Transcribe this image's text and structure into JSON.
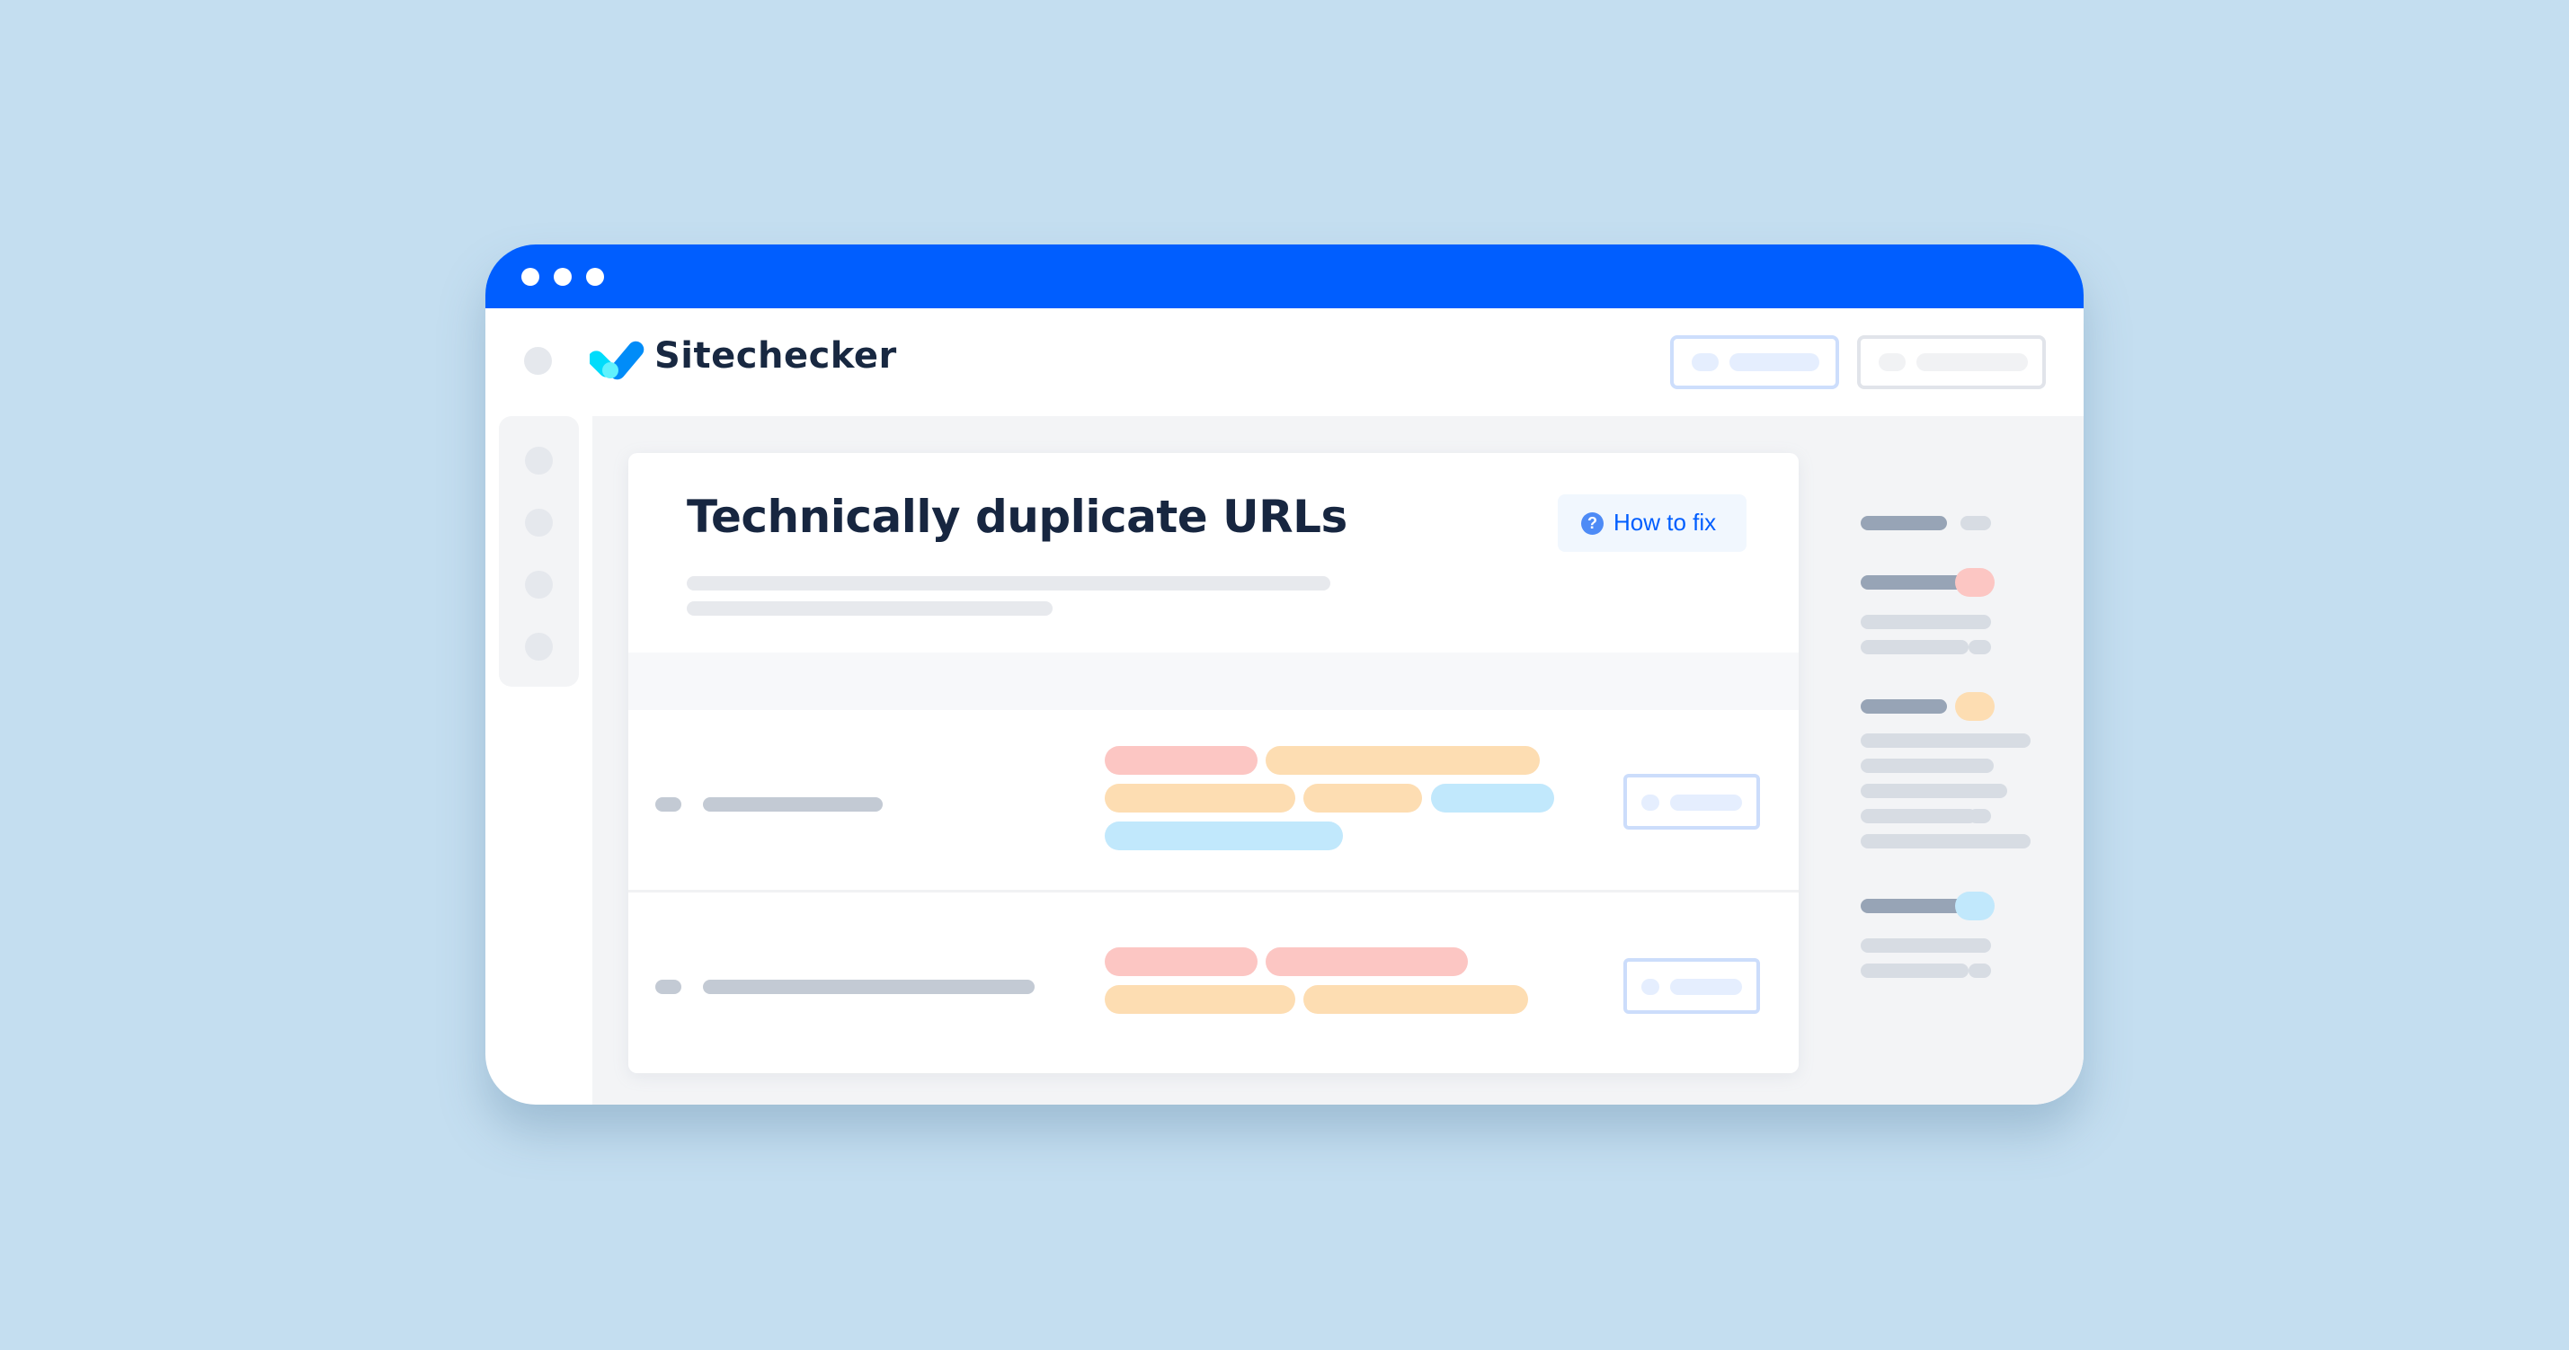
{
  "window": {
    "titlebar_color": "#005EFF",
    "traffic_dots": 3
  },
  "header": {
    "logo_text": "Sitechecker",
    "logo_icon": "checkmark-logo-icon",
    "buttons": [
      {
        "name": "primary-header-button",
        "style": "blue-outline"
      },
      {
        "name": "secondary-header-button",
        "style": "gray-outline"
      }
    ]
  },
  "sidebar": {
    "items": [
      "nav-item-1",
      "nav-item-2",
      "nav-item-3",
      "nav-item-4"
    ]
  },
  "main": {
    "title": "Technically duplicate URLs",
    "how_to_fix": {
      "label": "How to fix",
      "icon": "question-circle-icon",
      "icon_glyph": "?"
    },
    "rows": [
      {
        "tags": [
          "red",
          "orange",
          "orange",
          "orange",
          "blue",
          "blue"
        ]
      },
      {
        "tags": [
          "red",
          "red",
          "orange",
          "orange"
        ]
      }
    ]
  },
  "right_panel": {
    "groups": [
      {
        "badge": "none"
      },
      {
        "badge": "red"
      },
      {
        "badge": "orange"
      },
      {
        "badge": "blue"
      }
    ]
  },
  "colors": {
    "accent": "#005EFF",
    "title_text": "#172640",
    "tag_red": "#FCC6C3",
    "tag_orange": "#FDDDB2",
    "tag_blue": "#C1E8FC",
    "background": "#C4DEF0"
  }
}
